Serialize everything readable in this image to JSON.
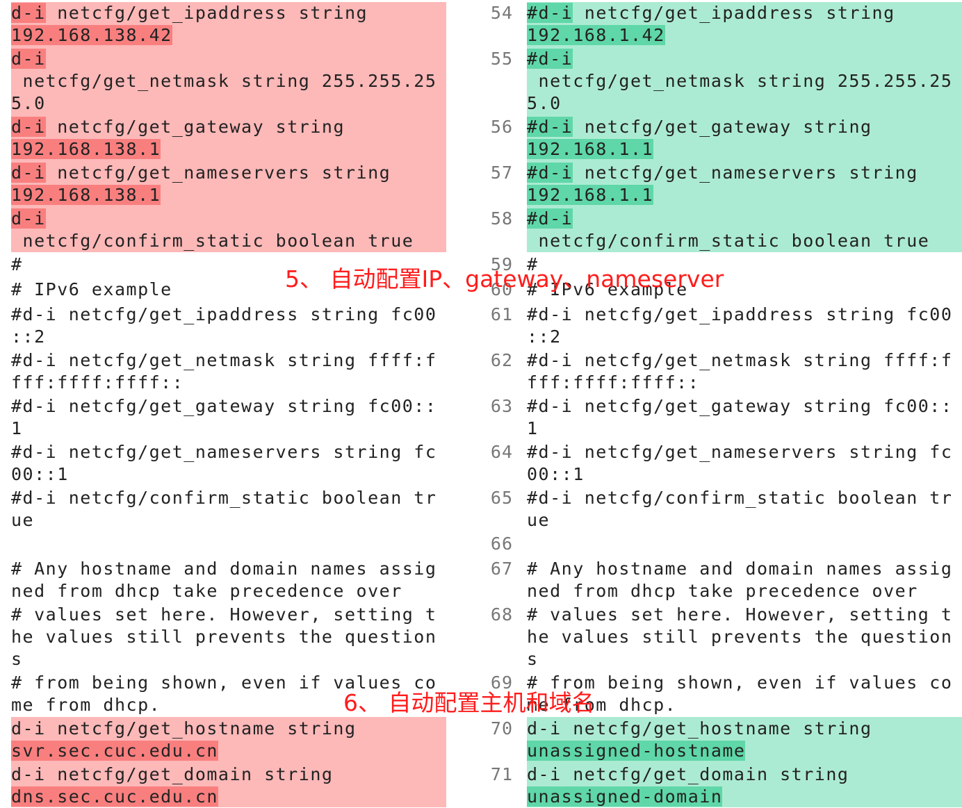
{
  "annotations": {
    "a5": "5、 自动配置IP、gateway、nameserver",
    "a6": "6、 自动配置主机和域名"
  },
  "colors": {
    "removed_bg": "#fdb8b8",
    "removed_highlight": "#f97f7f",
    "added_bg": "#acebd3",
    "added_highlight": "#5fd7a8",
    "annotation": "#ff1c1c"
  },
  "left": {
    "b1": {
      "h1": "d-i",
      "t1": " netcfg/get_ipaddress string",
      "h2": "192.168.138.42"
    },
    "b2": {
      "h1": "d-i",
      "t1": " netcfg/get_netmask string 255.255.25",
      "t2": "5.0"
    },
    "b3": {
      "h1": "d-i",
      "t1": " netcfg/get_gateway string",
      "h2": "192.168.138.1"
    },
    "b4": {
      "h1": "d-i",
      "t1": " netcfg/get_nameservers string",
      "h2": "192.168.138.1"
    },
    "b5": {
      "h1": "d-i",
      "t1": " netcfg/confirm_static boolean true"
    },
    "c59": "#",
    "c60": "# IPv6 example",
    "c61": [
      "#d-i netcfg/get_ipaddress string fc00",
      "::2"
    ],
    "c62": [
      "#d-i netcfg/get_netmask string ffff:f",
      "fff:ffff:ffff::"
    ],
    "c63": [
      "#d-i netcfg/get_gateway string fc00::",
      "1"
    ],
    "c64": [
      "#d-i netcfg/get_nameservers string fc",
      "00::1"
    ],
    "c65": [
      "#d-i netcfg/confirm_static boolean tr",
      "ue"
    ],
    "c67": [
      "# Any hostname and domain names assig",
      "ned from dhcp take precedence over"
    ],
    "c68": [
      "# values set here. However, setting t",
      "he values still prevents the question",
      "s"
    ],
    "c69": [
      "# from being shown, even if values co",
      "me from dhcp."
    ],
    "b70": {
      "t1": "d-i netcfg/get_hostname string",
      "h2": "svr.sec.cuc.edu.cn"
    },
    "b71": {
      "t1": "d-i netcfg/get_domain string",
      "h2": "dns.sec.cuc.edu.cn"
    }
  },
  "right": {
    "n54": "54",
    "n55": "55",
    "n56": "56",
    "n57": "57",
    "n58": "58",
    "n59": "59",
    "n60": "60",
    "n61": "61",
    "n62": "62",
    "n63": "63",
    "n64": "64",
    "n65": "65",
    "n66": "66",
    "n67": "67",
    "n68": "68",
    "n69": "69",
    "n70": "70",
    "n71": "71",
    "b1": {
      "h1": "#d-i",
      "t1": " netcfg/get_ipaddress string",
      "h2": "192.168.1.42"
    },
    "b2": {
      "h1": "#d-i",
      "t1": " netcfg/get_netmask string 255.255.25",
      "t2": "5.0"
    },
    "b3": {
      "h1": "#d-i",
      "t1": " netcfg/get_gateway string",
      "h2": "192.168.1.1"
    },
    "b4": {
      "h1": "#d-i",
      "t1": " netcfg/get_nameservers string",
      "h2": "192.168.1.1"
    },
    "b5": {
      "h1": "#d-i",
      "t1": " netcfg/confirm_static boolean true"
    },
    "c59": "#",
    "c60": "# IPv6 example",
    "c61": [
      "#d-i netcfg/get_ipaddress string fc00",
      "::2"
    ],
    "c62": [
      "#d-i netcfg/get_netmask string ffff:f",
      "fff:ffff:ffff::"
    ],
    "c63": [
      "#d-i netcfg/get_gateway string fc00::",
      "1"
    ],
    "c64": [
      "#d-i netcfg/get_nameservers string fc",
      "00::1"
    ],
    "c65": [
      "#d-i netcfg/confirm_static boolean tr",
      "ue"
    ],
    "c67": [
      "# Any hostname and domain names assig",
      "ned from dhcp take precedence over"
    ],
    "c68": [
      "# values set here. However, setting t",
      "he values still prevents the question",
      "s"
    ],
    "c69": [
      "# from being shown, even if values co",
      "me from dhcp."
    ],
    "b70": {
      "t1": "d-i netcfg/get_hostname string",
      "h2": "unassigned-hostname"
    },
    "b71": {
      "t1": "d-i netcfg/get_domain string",
      "h2": "unassigned-domain"
    }
  }
}
